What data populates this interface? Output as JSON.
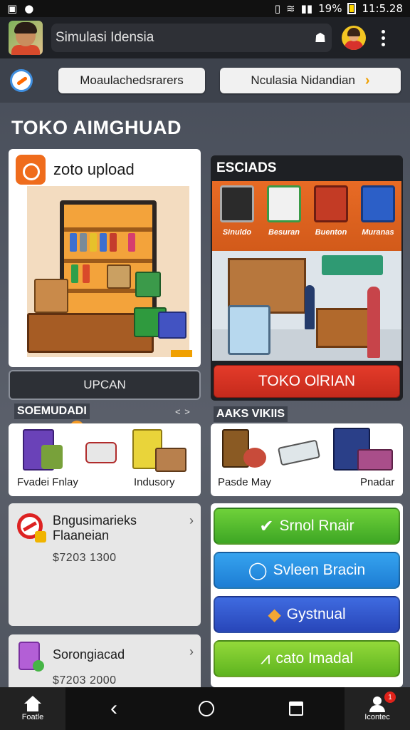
{
  "status_bar": {
    "battery": "19%",
    "time": "11:5.28"
  },
  "app_bar": {
    "title": "Simulasi Idensia"
  },
  "tabs": [
    {
      "label": "Moaulachedsrarers"
    },
    {
      "label": "Nculasia Nidandian"
    }
  ],
  "page_title": "TOKO AIMGHUAD",
  "upload_card": {
    "label": "zoto upload",
    "button_label": "UPCAN"
  },
  "services": {
    "header": "ESCIADS",
    "items": [
      {
        "caption": "Sinuldo",
        "color": "#2b2b2b"
      },
      {
        "caption": "Besuran",
        "color": "#e8e8e8"
      },
      {
        "caption": "Buenton",
        "color": "#c33b25"
      },
      {
        "caption": "Muranas",
        "color": "#2c5fc7"
      }
    ],
    "button_label": "TOKO OlRIAN"
  },
  "section_left": {
    "label": "SOEMUDADI",
    "arrows": "< >",
    "products": [
      {
        "caption": "Fvadei Fnlay"
      },
      {
        "caption": "Indusory"
      }
    ]
  },
  "section_right": {
    "label": "AAKS VIKIIS",
    "products": [
      {
        "caption": "Pasde May"
      },
      {
        "caption": "Pnadar"
      }
    ]
  },
  "list_items": [
    {
      "title_line1": "Bngusimarieks",
      "title_line2": "Flaaneian",
      "price": "$7203 1300"
    },
    {
      "title_line1": "Sorongiacad",
      "title_line2": "",
      "price": "$7203 2000"
    }
  ],
  "actions": [
    {
      "label": "Srnol Rnair",
      "icon": "check-icon",
      "color": "#4cbb2a"
    },
    {
      "label": "Svleen Bracin",
      "icon": "chat-icon",
      "color": "#2a90e3"
    },
    {
      "label": "Gystnual",
      "icon": "shield-icon",
      "color": "#3357cf"
    },
    {
      "label": "cato Imadal",
      "icon": "growth-icon",
      "color": "#7acb2c"
    }
  ],
  "bottom_nav": {
    "home_label": "Foatle",
    "contact_label": "Icontec",
    "notification_count": "1"
  },
  "colors": {
    "accent_orange": "#ef6c1c",
    "primary_red": "#d4301f",
    "background": "#4e535d"
  }
}
